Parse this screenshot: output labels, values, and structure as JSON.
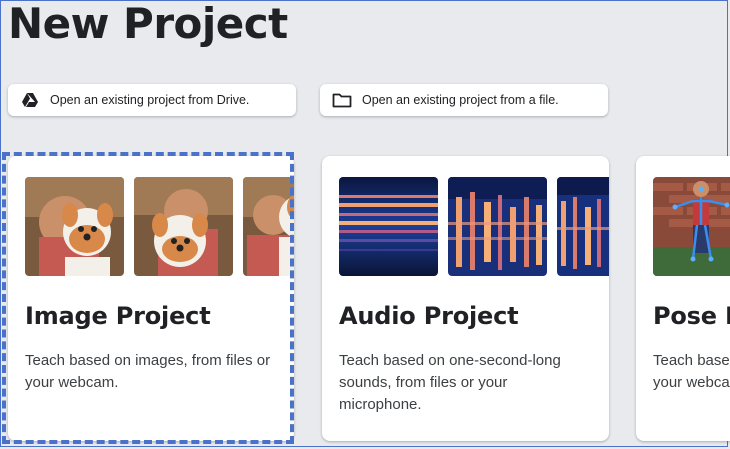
{
  "header": {
    "title": "New Project"
  },
  "open_buttons": {
    "drive": {
      "label": "Open an existing project from Drive.",
      "icon": "google-drive-icon"
    },
    "file": {
      "label": "Open an existing project from a file.",
      "icon": "folder-icon"
    }
  },
  "cards": {
    "image": {
      "title": "Image Project",
      "description": "Teach based on images, from files or your webcam.",
      "selected": true
    },
    "audio": {
      "title": "Audio Project",
      "description": "Teach based on one-second-long sounds, from files or your microphone."
    },
    "pose": {
      "title": "Pose Project",
      "description": "Teach based on images, from files or your webcam."
    }
  },
  "colors": {
    "background": "#e8eaed",
    "card": "#ffffff",
    "selection_outline": "#4a72c8",
    "text": "#202124"
  }
}
